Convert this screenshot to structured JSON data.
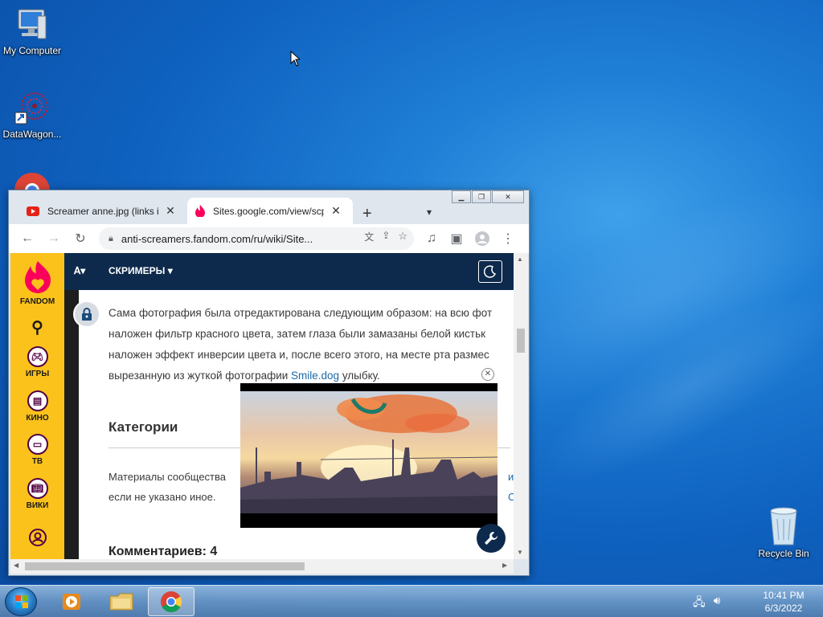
{
  "desktop": {
    "icons": [
      {
        "label": "My Computer"
      },
      {
        "label": "DataWagon..."
      },
      {
        "label": "Recycle Bin"
      }
    ]
  },
  "browser": {
    "tabs": [
      {
        "title": "Screamer anne.jpg (links in"
      },
      {
        "title": "Sites.google.com/view/scp"
      }
    ],
    "url": "anti-screamers.fandom.com/ru/wiki/Site...",
    "page": {
      "fandom_label": "FANDOM",
      "rail": [
        {
          "label": "ИГРЫ"
        },
        {
          "label": "КИНО"
        },
        {
          "label": "ТВ"
        },
        {
          "label": "ВИКИ"
        }
      ],
      "header_logo": "ꓮ▾",
      "header_menu": "СКРИМЕРЫ ▾",
      "article_lines": [
        "Сама фотография была отредактирована следующим образом: на всю фот",
        "наложен фильтр красного цвета, затем глаза были замазаны белой кистьк",
        "наложен эффект инверсии цвета и, после всего этого, на месте рта размес"
      ],
      "article_last_prefix": "вырезанную из жуткой фотографии ",
      "article_link": "Smile.dog",
      "article_last_suffix": " улыбку.",
      "categories_title": "Категории",
      "license_line1": "Материалы сообщества",
      "license_more": "и C",
      "license_line2": "если не указано иное.",
      "comments_title": "Комментариев: 4"
    }
  },
  "taskbar": {
    "time": "10:41 PM",
    "date": "6/3/2022"
  }
}
